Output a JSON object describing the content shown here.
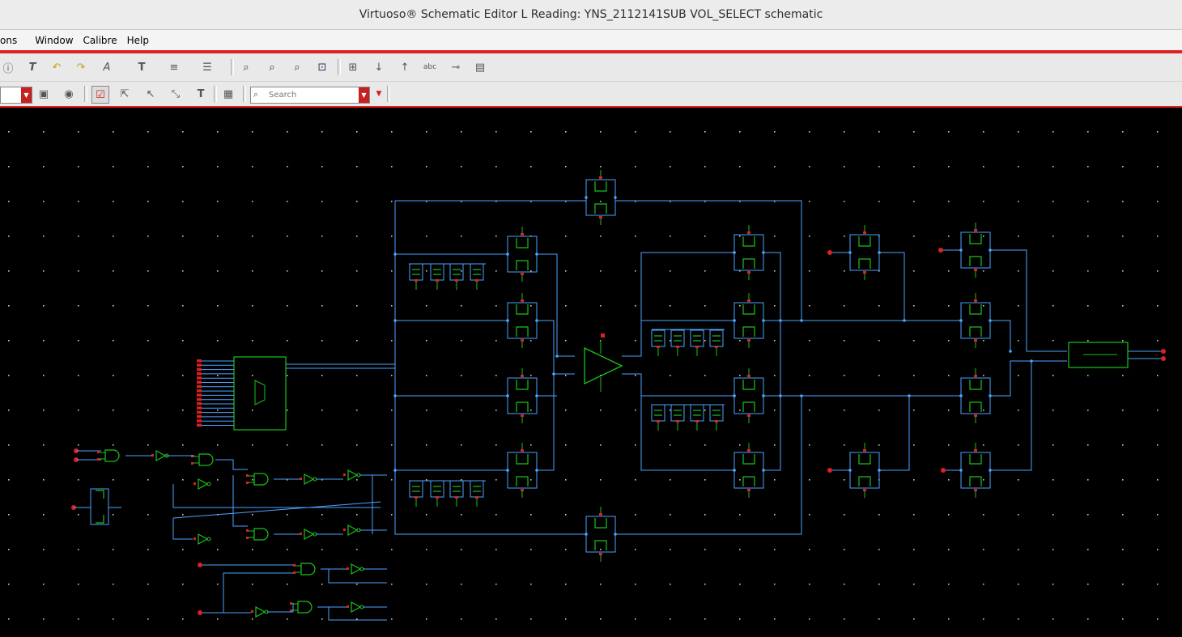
{
  "window": {
    "title": "Virtuoso® Schematic Editor L Reading: YNS_2112141SUB VOL_SELECT schematic"
  },
  "menu": {
    "items": [
      "ons",
      "Window",
      "Calibre",
      "Help"
    ]
  },
  "toolbar": {
    "search_placeholder": "Search",
    "icons": [
      "info-icon",
      "text-tool-icon",
      "undo-icon",
      "redo-icon",
      "rotate-text-icon",
      "font-size-icon",
      "align-icon",
      "distribute-icon",
      "zoom-fit-icon",
      "zoom-in-icon",
      "zoom-out-icon",
      "zoom-area-icon",
      "hierarchy-icon",
      "descend-icon",
      "ascend-icon",
      "label-icon",
      "pin-icon",
      "properties-icon"
    ]
  },
  "colors": {
    "wire": "#4da3ff",
    "device": "#19c419",
    "pin": "#e02020",
    "grid": "#c8c8c8",
    "accent": "#d22222"
  }
}
